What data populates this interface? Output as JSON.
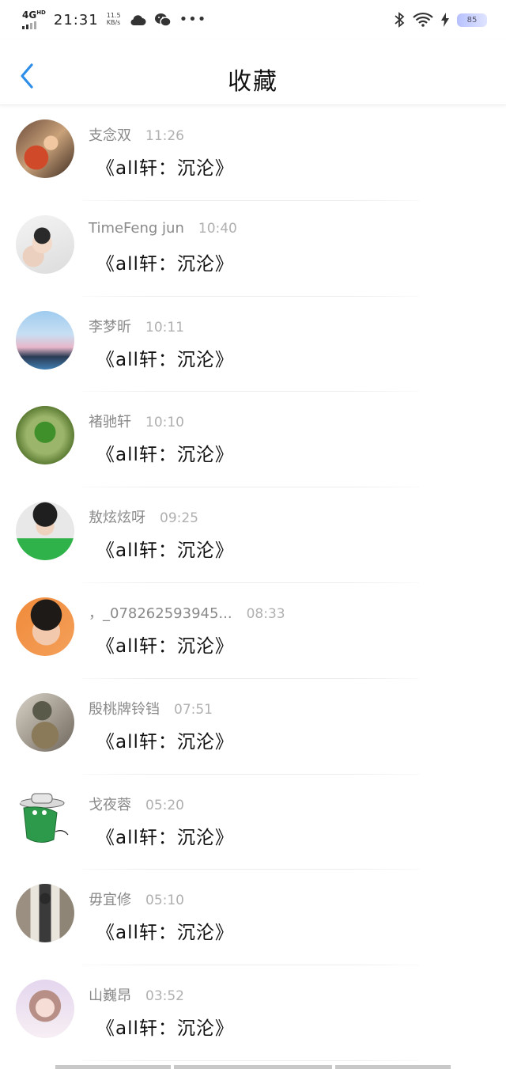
{
  "status_bar": {
    "network": "4G",
    "network_hd": "HD",
    "time": "21:31",
    "speed_value": "11.5",
    "speed_unit": "KB/s",
    "battery": "85",
    "icons": [
      "cloud-icon",
      "wechat-icon",
      "more-dots-icon",
      "bluetooth-icon",
      "wifi-icon",
      "charging-icon",
      "battery-icon"
    ]
  },
  "header": {
    "title": "收藏",
    "back_icon": "chevron-left-icon",
    "accent_color": "#2f8ee8"
  },
  "items": [
    {
      "name": "支念双",
      "time": "11:26",
      "message": "《all轩：沉沦》",
      "avatar": "avatar-1"
    },
    {
      "name": "TimeFeng jun",
      "time": "10:40",
      "message": "《all轩：沉沦》",
      "avatar": "avatar-2"
    },
    {
      "name": "李梦昕",
      "time": "10:11",
      "message": "《all轩：沉沦》",
      "avatar": "avatar-3"
    },
    {
      "name": "褚驰轩",
      "time": "10:10",
      "message": "《all轩：沉沦》",
      "avatar": "avatar-4"
    },
    {
      "name": "敖炫炫呀",
      "time": "09:25",
      "message": "《all轩：沉沦》",
      "avatar": "avatar-5"
    },
    {
      "name": "，_078262593945...",
      "time": "08:33",
      "message": "《all轩：沉沦》",
      "avatar": "avatar-6"
    },
    {
      "name": "殷桃牌铃铛",
      "time": "07:51",
      "message": "《all轩：沉沦》",
      "avatar": "avatar-7"
    },
    {
      "name": "戈夜蓉",
      "time": "05:20",
      "message": "《all轩：沉沦》",
      "avatar": "avatar-8"
    },
    {
      "name": "毋宜修",
      "time": "05:10",
      "message": "《all轩：沉沦》",
      "avatar": "avatar-9"
    },
    {
      "name": "山巍昂",
      "time": "03:52",
      "message": "《all轩：沉沦》",
      "avatar": "avatar-10"
    }
  ]
}
